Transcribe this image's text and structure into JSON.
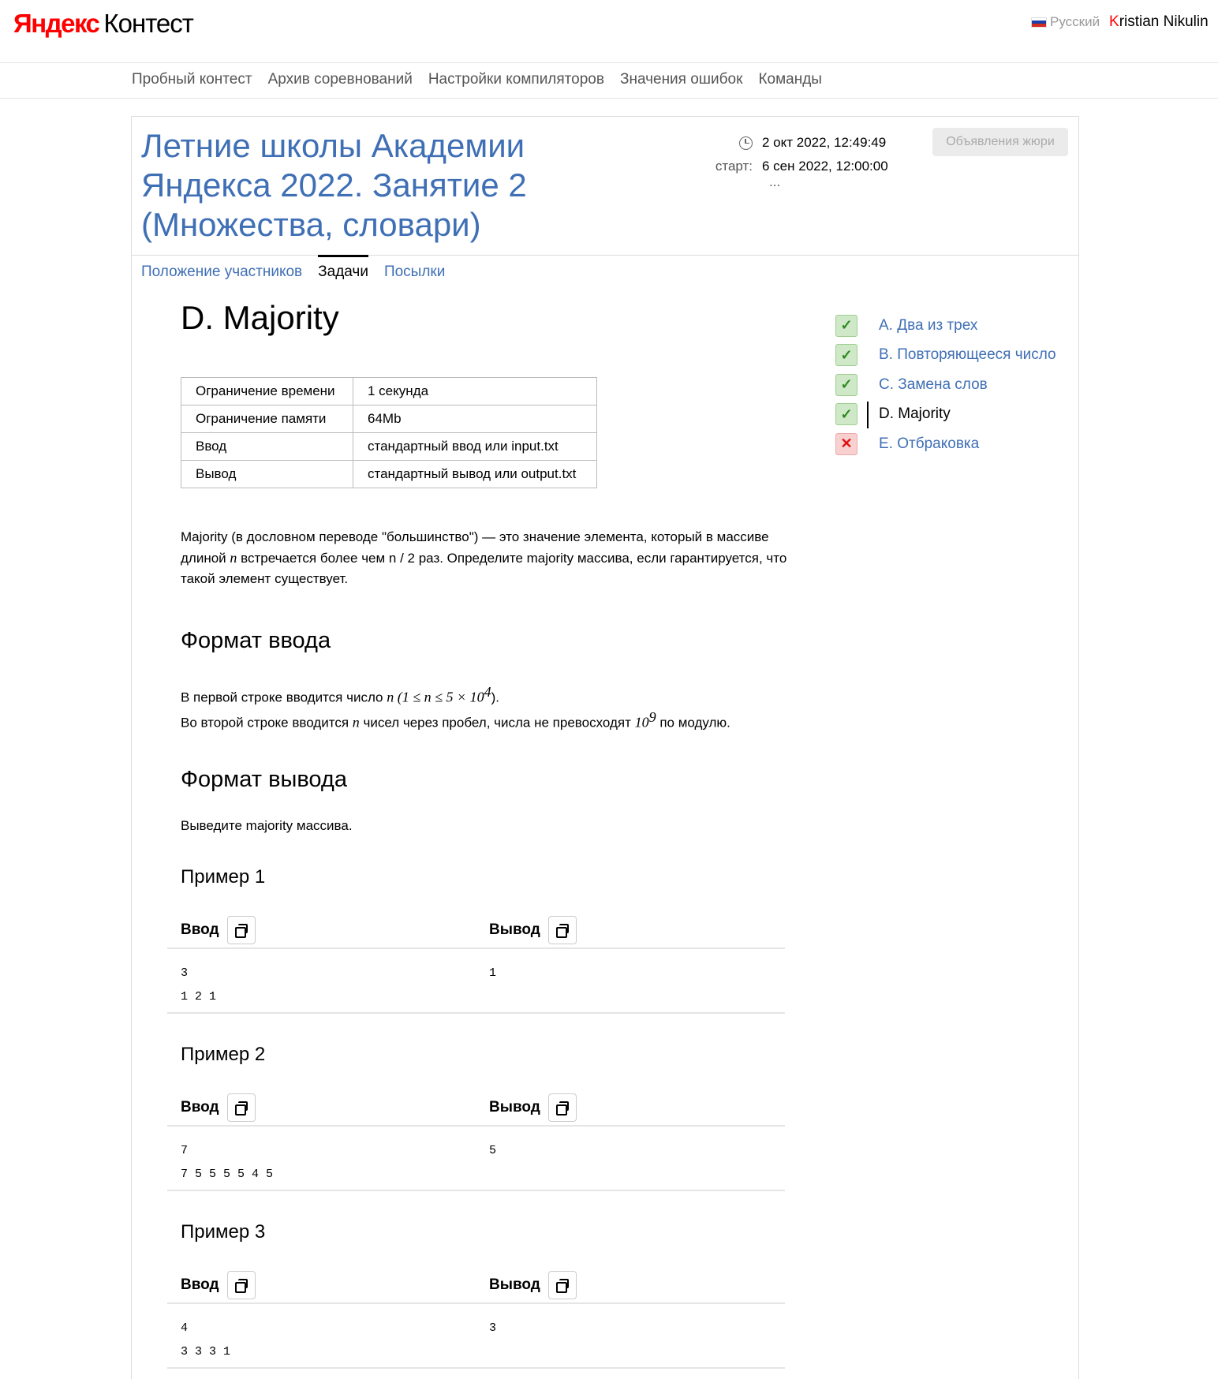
{
  "header": {
    "logo_ya": "Яндекс",
    "logo_kontest": "Контест",
    "language": "Русский",
    "user_first_letter": "K",
    "user_rest": "ristian Nikulin"
  },
  "menu": [
    "Пробный контест",
    "Архив соревнований",
    "Настройки компиляторов",
    "Значения ошибок",
    "Команды"
  ],
  "contest": {
    "title": "Летние школы Академии Яндекса 2022. Занятие 2 (Множества, словари)",
    "current_time": "2 окт 2022, 12:49:49",
    "start_label": "старт:",
    "start_time": "6 сен 2022, 12:00:00",
    "more": "...",
    "jury_button": "Объявления жюри",
    "tabs": [
      "Положение участников",
      "Задачи",
      "Посылки"
    ]
  },
  "problem": {
    "title": "D. Majority",
    "limits": [
      [
        "Ограничение времени",
        "1 секунда"
      ],
      [
        "Ограничение памяти",
        "64Mb"
      ],
      [
        "Ввод",
        "стандартный ввод или input.txt"
      ],
      [
        "Вывод",
        "стандартный вывод или output.txt"
      ]
    ],
    "legend_1": "Majority (в дословном переводе \"большинство\") — это значение элемента, который в массиве длиной ",
    "legend_n": "n",
    "legend_2": " встречается более чем n / 2 раз. Определите majority массива, если гарантируется, что такой элемент существует.",
    "input_heading": "Формат ввода",
    "input_line1_a": "В первой строке вводится число ",
    "input_line1_math": "n (1 ≤ n ≤ 5 × 10",
    "input_line1_sup": "4",
    "input_line1_b": ").",
    "input_line2_a": "Во второй строке вводится ",
    "input_line2_n": "n",
    "input_line2_b": " чисел через пробел, числа не превосходят ",
    "input_line2_math": "10",
    "input_line2_sup": "9",
    "input_line2_c": " по модулю.",
    "output_heading": "Формат вывода",
    "output_text": "Выведите majority массива.",
    "examples": [
      {
        "title": "Пример 1",
        "input_label": "Ввод",
        "output_label": "Вывод",
        "input": "3\n1 2 1",
        "output": "1"
      },
      {
        "title": "Пример 2",
        "input_label": "Ввод",
        "output_label": "Вывод",
        "input": "7\n7 5 5 5 5 4 5",
        "output": "5"
      },
      {
        "title": "Пример 3",
        "input_label": "Ввод",
        "output_label": "Вывод",
        "input": "4\n3 3 3 1",
        "output": "3"
      }
    ]
  },
  "problem_list": [
    {
      "label": "A. Два из трех",
      "status": "ok",
      "icon": "check-icon",
      "symbol": "✓"
    },
    {
      "label": "B. Повторяющееся число",
      "status": "ok",
      "icon": "check-icon",
      "symbol": "✓"
    },
    {
      "label": "C. Замена слов",
      "status": "ok",
      "icon": "check-icon",
      "symbol": "✓"
    },
    {
      "label": "D. Majority",
      "status": "ok",
      "icon": "check-icon",
      "symbol": "✓"
    },
    {
      "label": "E. Отбраковка",
      "status": "fail",
      "icon": "cross-icon",
      "symbol": "✕"
    }
  ]
}
